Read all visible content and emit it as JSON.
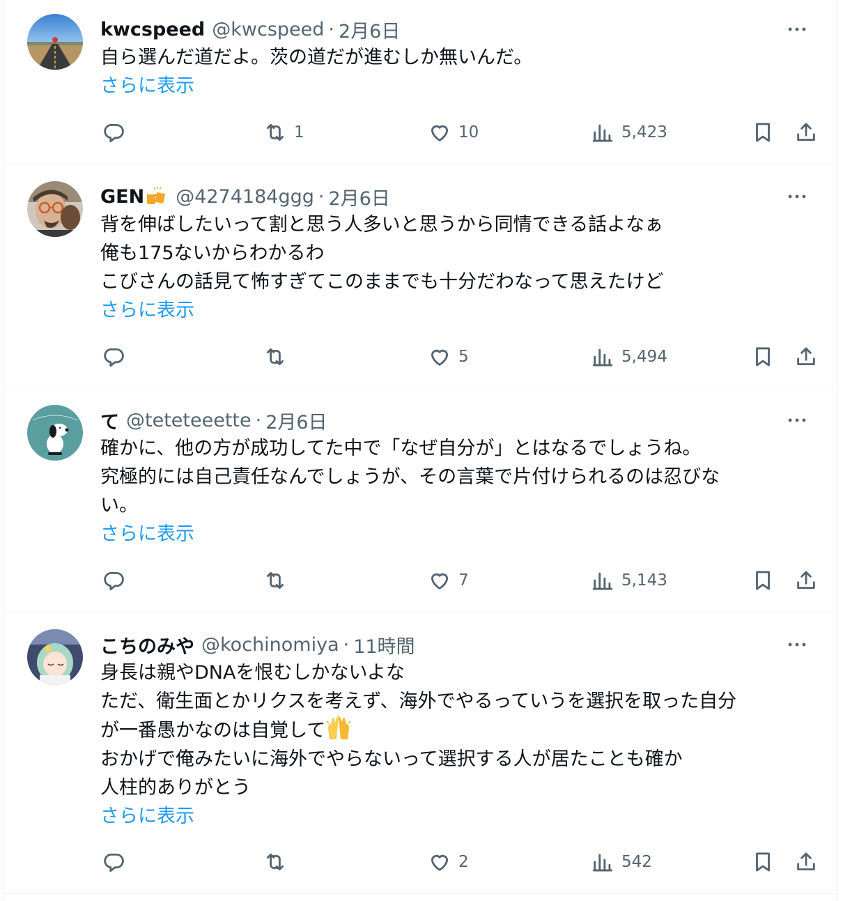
{
  "tweets": [
    {
      "name": "kwcspeed",
      "handle": "@kwcspeed",
      "separator": "·",
      "time": "2月6日",
      "lines": [
        "自ら選んだ道だよ。茨の道だが進むしか無いんだ。"
      ],
      "show_more": "さらに表示",
      "replies": "",
      "retweets": "1",
      "likes": "10",
      "views": "5,423"
    },
    {
      "name": "GEN",
      "name_emoji": "beer-mugs-emoji",
      "handle": "@4274184ggg",
      "separator": "·",
      "time": "2月6日",
      "lines": [
        "背を伸ばしたいって割と思う人多いと思うから同情できる話よなぁ",
        "俺も175ないからわかるわ",
        "こびさんの話見て怖すぎてこのままでも十分だわなって思えたけど"
      ],
      "show_more": "さらに表示",
      "replies": "",
      "retweets": "",
      "likes": "5",
      "views": "5,494"
    },
    {
      "name": "て",
      "handle": "@teteteeette",
      "separator": "·",
      "time": "2月6日",
      "lines": [
        "確かに、他の方が成功してた中で「なぜ自分が」とはなるでしょうね。",
        "究極的には自己責任なんでしょうが、その言葉で片付けられるのは忍びな",
        "い。"
      ],
      "show_more": "さらに表示",
      "replies": "",
      "retweets": "",
      "likes": "7",
      "views": "5,143"
    },
    {
      "name": "こちのみや",
      "handle": "@kochinomiya",
      "separator": "·",
      "time": "11時間",
      "lines": [
        "身長は親やDNAを恨むしかないよな",
        "ただ、衛生面とかリクスを考えず、海外でやるっていうを選択を取った自分",
        "が一番愚かなのは自覚して",
        "おかげで俺みたいに海外でやらないって選択する人が居たことも確か",
        "人柱的ありがとう"
      ],
      "inline_emoji": "raising-hands-emoji",
      "show_more": "さらに表示",
      "replies": "",
      "retweets": "",
      "likes": "2",
      "views": "542"
    }
  ],
  "icons": {
    "reply": "reply-icon",
    "retweet": "retweet-icon",
    "like": "heart-icon",
    "views": "views-icon",
    "bookmark": "bookmark-icon",
    "share": "share-icon",
    "more": "more-icon"
  },
  "colors": {
    "link": "#1d9bf0",
    "secondary": "#536471",
    "text": "#0f1419",
    "divider": "#eff3f4"
  }
}
